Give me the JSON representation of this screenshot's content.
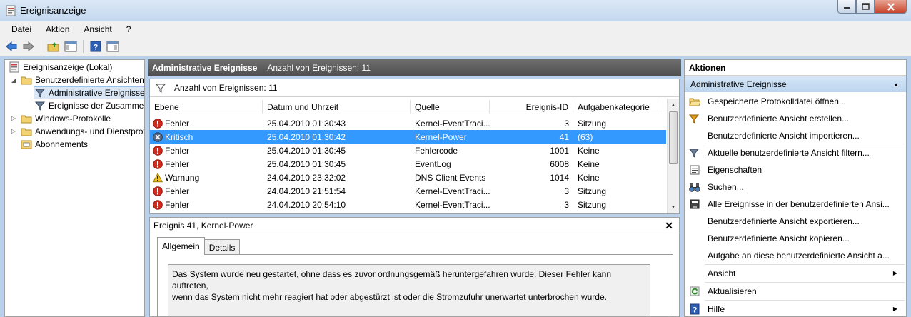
{
  "window": {
    "title": "Ereignisanzeige"
  },
  "menu": [
    "Datei",
    "Aktion",
    "Ansicht",
    "?"
  ],
  "tree": {
    "root": "Ereignisanzeige (Lokal)",
    "custom_views": "Benutzerdefinierte Ansichten",
    "admin_events": "Administrative Ereignisse",
    "summary_events": "Ereignisse der Zusammenfassung",
    "windows_logs": "Windows-Protokolle",
    "app_service_logs": "Anwendungs- und Dienstprotokolle",
    "subscriptions": "Abonnements"
  },
  "center": {
    "title": "Administrative Ereignisse",
    "count_header": "Anzahl von Ereignissen: 11",
    "filter_text": "Anzahl von Ereignissen: 11",
    "columns": [
      "Ebene",
      "Datum und Uhrzeit",
      "Quelle",
      "Ereignis-ID",
      "Aufgabenkategorie"
    ],
    "rows": [
      {
        "level": "Fehler",
        "icon": "error",
        "date": "25.04.2010 01:30:43",
        "source": "Kernel-EventTraci...",
        "id": "3",
        "category": "Sitzung"
      },
      {
        "level": "Kritisch",
        "icon": "critical",
        "date": "25.04.2010 01:30:42",
        "source": "Kernel-Power",
        "id": "41",
        "category": "(63)"
      },
      {
        "level": "Fehler",
        "icon": "error",
        "date": "25.04.2010 01:30:45",
        "source": "Fehlercode",
        "id": "1001",
        "category": "Keine"
      },
      {
        "level": "Fehler",
        "icon": "error",
        "date": "25.04.2010 01:30:45",
        "source": "EventLog",
        "id": "6008",
        "category": "Keine"
      },
      {
        "level": "Warnung",
        "icon": "warning",
        "date": "24.04.2010 23:32:02",
        "source": "DNS Client Events",
        "id": "1014",
        "category": "Keine"
      },
      {
        "level": "Fehler",
        "icon": "error",
        "date": "24.04.2010 21:51:54",
        "source": "Kernel-EventTraci...",
        "id": "3",
        "category": "Sitzung"
      },
      {
        "level": "Fehler",
        "icon": "error",
        "date": "24.04.2010 20:54:10",
        "source": "Kernel-EventTraci...",
        "id": "3",
        "category": "Sitzung"
      }
    ],
    "selected_row": 1
  },
  "detail": {
    "title": "Ereignis 41, Kernel-Power",
    "tabs": [
      "Allgemein",
      "Details"
    ],
    "description_line1": "Das System wurde neu gestartet, ohne dass es zuvor ordnungsgemäß heruntergefahren wurde. Dieser Fehler kann auftreten,",
    "description_line2": "wenn das System nicht mehr reagiert hat oder abgestürzt ist oder die Stromzufuhr unerwartet unterbrochen wurde."
  },
  "actions": {
    "header": "Aktionen",
    "section": "Administrative Ereignisse",
    "items": [
      {
        "label": "Gespeicherte Protokolldatei öffnen...",
        "icon": "folder-open-icon"
      },
      {
        "label": "Benutzerdefinierte Ansicht erstellen...",
        "icon": "filter-create-icon"
      },
      {
        "label": "Benutzerdefinierte Ansicht importieren...",
        "icon": ""
      },
      {
        "label": "Aktuelle benutzerdefinierte Ansicht filtern...",
        "icon": "filter-icon"
      },
      {
        "label": "Eigenschaften",
        "icon": "properties-icon"
      },
      {
        "label": "Suchen...",
        "icon": "binoculars-icon"
      },
      {
        "label": "Alle Ereignisse in der benutzerdefinierten Ansi...",
        "icon": "save-icon"
      },
      {
        "label": "Benutzerdefinierte Ansicht exportieren...",
        "icon": ""
      },
      {
        "label": "Benutzerdefinierte Ansicht kopieren...",
        "icon": ""
      },
      {
        "label": "Aufgabe an diese benutzerdefinierte Ansicht a...",
        "icon": ""
      },
      {
        "label": "Ansicht",
        "icon": ""
      },
      {
        "label": "Aktualisieren",
        "icon": "refresh-icon"
      },
      {
        "label": "Hilfe",
        "icon": "help-icon"
      }
    ]
  },
  "colors": {
    "selection": "#3399ff",
    "header_dark": "#5a5a5a",
    "action_section": "#c8dcf1",
    "error_red": "#d42a1d",
    "warning_yellow": "#f2c21a"
  }
}
